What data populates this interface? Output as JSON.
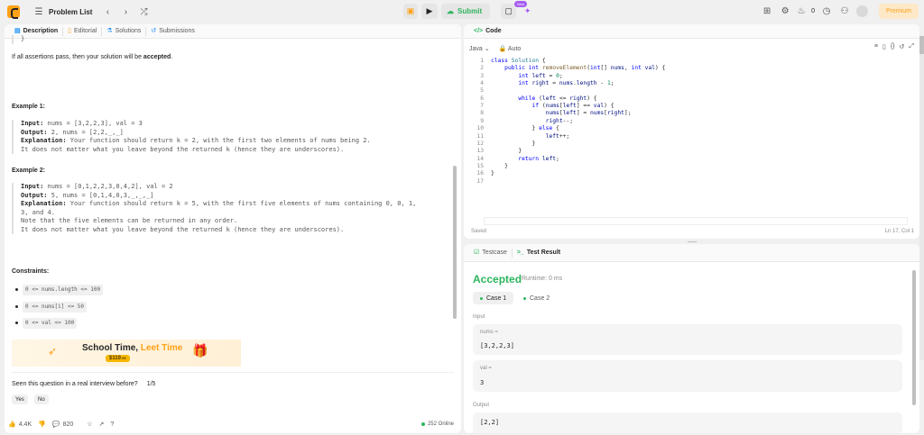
{
  "topbar": {
    "problem_list": "Problem List",
    "submit": "Submit",
    "new_badge": "New",
    "streak_count": "0",
    "premium": "Premium"
  },
  "left_tabs": [
    "Description",
    "Editorial",
    "Solutions",
    "Submissions"
  ],
  "description": {
    "top_fragment": "}",
    "assert_text": "If all assertions pass, then your solution will be",
    "assert_bold": "accepted",
    "assert_end": ".",
    "example1_title": "Example 1:",
    "example1_lines": [
      {
        "label": "Input:",
        "text": " nums = [3,2,2,3], val = 3"
      },
      {
        "label": "Output:",
        "text": " 2, nums = [2,2,_,_]"
      },
      {
        "label": "Explanation:",
        "text": " Your function should return k = 2, with the first two elements of nums being 2."
      },
      {
        "label": "",
        "text": "It does not matter what you leave beyond the returned k (hence they are underscores)."
      }
    ],
    "example2_title": "Example 2:",
    "example2_lines": [
      {
        "label": "Input:",
        "text": " nums = [0,1,2,2,3,0,4,2], val = 2"
      },
      {
        "label": "Output:",
        "text": " 5, nums = [0,1,4,0,3,_,_,_]"
      },
      {
        "label": "Explanation:",
        "text": " Your function should return k = 5, with the first five elements of nums containing 0, 0, 1,"
      },
      {
        "label": "",
        "text": "3, and 4."
      },
      {
        "label": "",
        "text": "Note that the five elements can be returned in any order."
      },
      {
        "label": "",
        "text": "It does not matter what you leave beyond the returned k (hence they are underscores)."
      }
    ],
    "constraints_title": "Constraints:",
    "constraints": [
      "0 <= nums.length <= 100",
      "0 <= nums[i] <= 50",
      "0 <= val <= 100"
    ],
    "banner_title_a": "School Time, ",
    "banner_title_b": "Leet Time",
    "banner_price": "$119",
    "banner_price_suffix": ".99",
    "interview_q": "Seen this question in a real interview before?",
    "interview_page": "1/5",
    "yes": "Yes",
    "no": "No"
  },
  "footer": {
    "likes": "4.4K",
    "comments": "820",
    "online": "252 Online"
  },
  "code": {
    "tab": "Code",
    "language": "Java",
    "auto": "Auto",
    "saved": "Saved",
    "cursor": "Ln 17, Col 1",
    "line_numbers": [
      "1",
      "2",
      "3",
      "4",
      "5",
      "6",
      "7",
      "8",
      "9",
      "10",
      "11",
      "12",
      "13",
      "14",
      "15",
      "16",
      "17"
    ]
  },
  "tests": {
    "tab_testcase": "Testcase",
    "tab_result": "Test Result",
    "status": "Accepted",
    "runtime": "Runtime: 0 ms",
    "case1": "Case 1",
    "case2": "Case 2",
    "input_label": "Input",
    "nums_key": "nums =",
    "nums_val": "[3,2,2,3]",
    "val_key": "val =",
    "val_val": "3",
    "output_label": "Output",
    "output_val": "[2,2]"
  },
  "colors": {
    "accent": "#ffa116",
    "success": "#2db55d"
  }
}
